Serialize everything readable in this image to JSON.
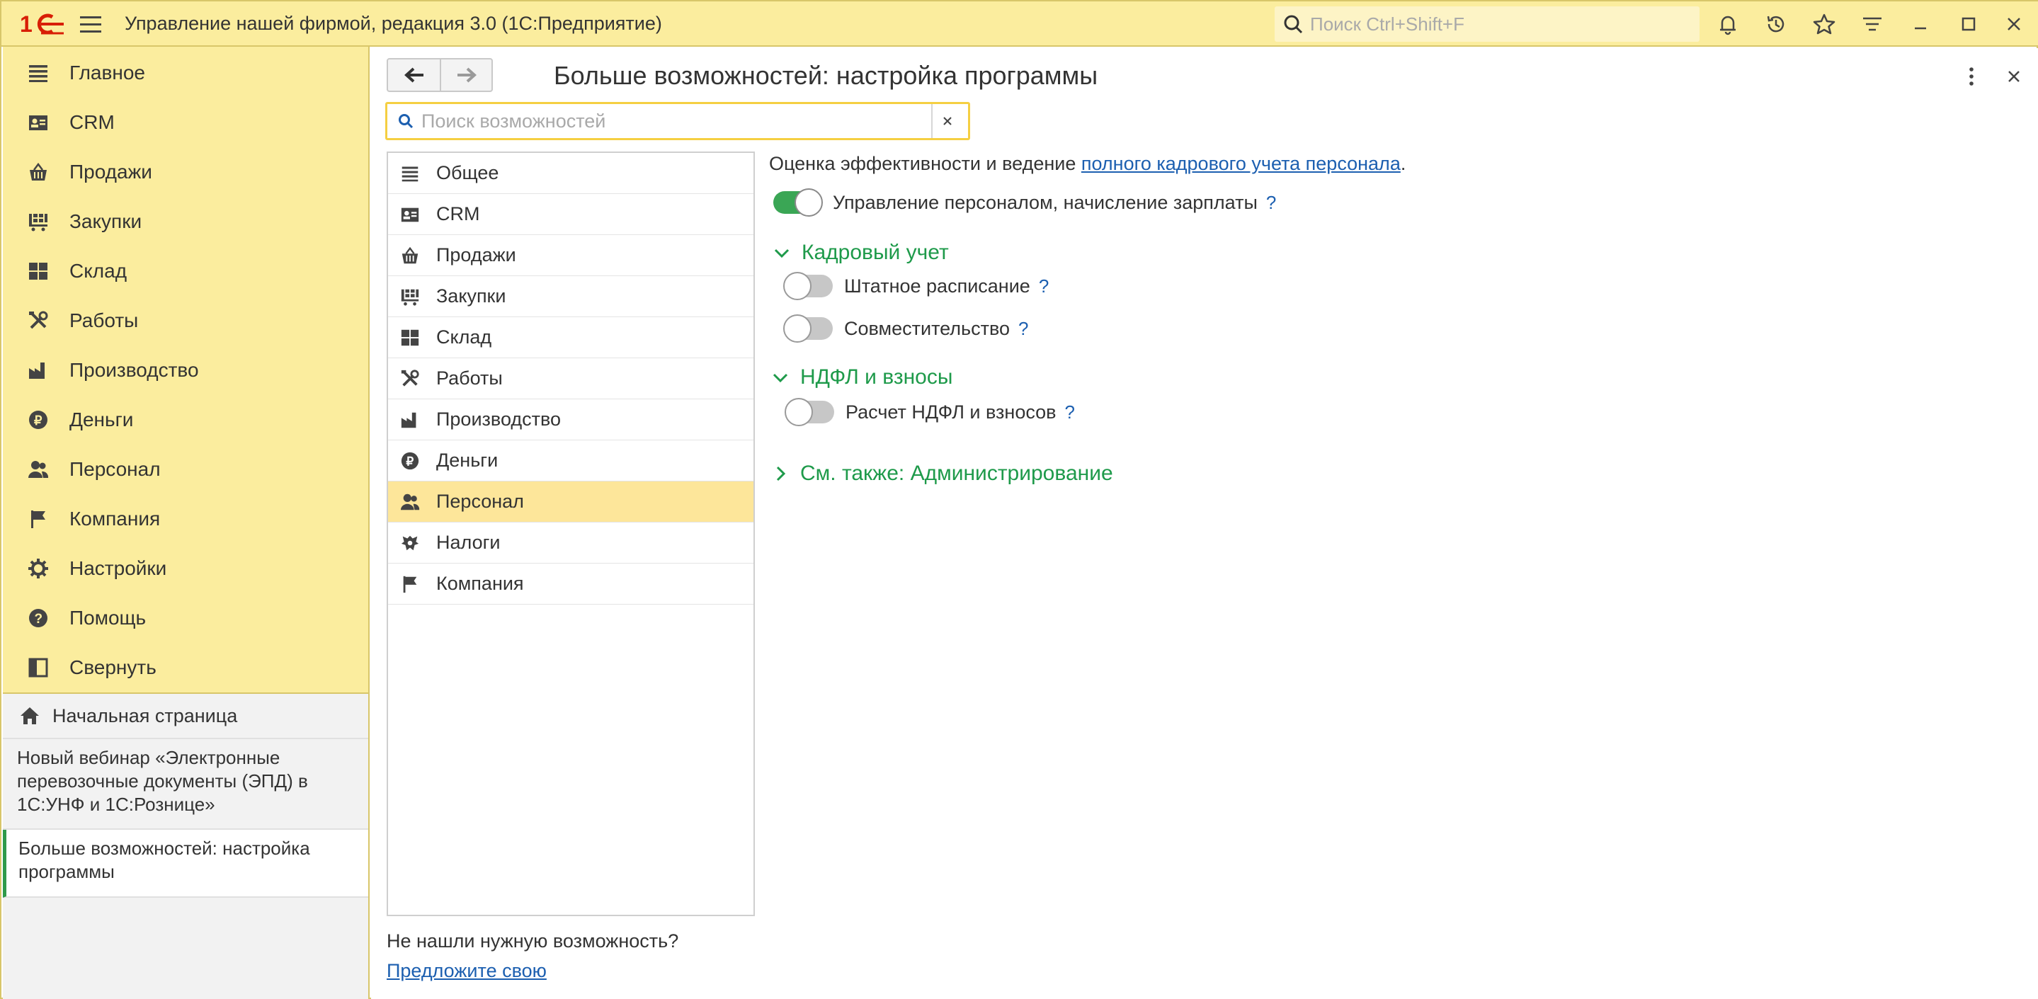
{
  "titlebar": {
    "app_title": "Управление нашей фирмой, редакция 3.0  (1С:Предприятие)",
    "search_placeholder": "Поиск Ctrl+Shift+F",
    "brand_color": "#d81e05",
    "accent_color": "#fbed9e"
  },
  "sidebar": {
    "items": [
      {
        "label": "Главное",
        "icon": "menu-lines-icon"
      },
      {
        "label": "CRM",
        "icon": "crm-card-icon"
      },
      {
        "label": "Продажи",
        "icon": "basket-icon"
      },
      {
        "label": "Закупки",
        "icon": "cart-icon"
      },
      {
        "label": "Склад",
        "icon": "warehouse-grid-icon"
      },
      {
        "label": "Работы",
        "icon": "tools-icon"
      },
      {
        "label": "Производство",
        "icon": "factory-icon"
      },
      {
        "label": "Деньги",
        "icon": "ruble-icon"
      },
      {
        "label": "Персонал",
        "icon": "people-icon"
      },
      {
        "label": "Компания",
        "icon": "flag-icon"
      },
      {
        "label": "Настройки",
        "icon": "gear-icon"
      },
      {
        "label": "Помощь",
        "icon": "help-icon"
      },
      {
        "label": "Свернуть",
        "icon": "collapse-panel-icon"
      }
    ]
  },
  "open_windows": {
    "home_label": "Начальная страница",
    "items": [
      {
        "label": "Новый вебинар «Электронные перевозочные документы (ЭПД) в 1С:УНФ и 1С:Рознице»",
        "active": false
      },
      {
        "label": "Больше возможностей: настройка программы",
        "active": true
      }
    ]
  },
  "main": {
    "title": "Больше возможностей: настройка программы",
    "search_placeholder": "Поиск возможностей",
    "sections": [
      {
        "label": "Общее",
        "active": false
      },
      {
        "label": "CRM",
        "active": false
      },
      {
        "label": "Продажи",
        "active": false
      },
      {
        "label": "Закупки",
        "active": false
      },
      {
        "label": "Склад",
        "active": false
      },
      {
        "label": "Работы",
        "active": false
      },
      {
        "label": "Производство",
        "active": false
      },
      {
        "label": "Деньги",
        "active": false
      },
      {
        "label": "Персонал",
        "active": true
      },
      {
        "label": "Налоги",
        "active": false
      },
      {
        "label": "Компания",
        "active": false
      }
    ],
    "not_found_text": "Не нашли нужную возможность?",
    "suggest_link": "Предложите свою"
  },
  "pane": {
    "intro_text": "Оценка эффективности и ведение ",
    "intro_link": "полного кадрового учета персонала",
    "intro_end": ".",
    "main_toggle": {
      "label": "Управление персоналом, начисление зарплаты",
      "on": true,
      "help": "?"
    },
    "groups": [
      {
        "title": "Кадровый учет",
        "expanded": true,
        "toggles": [
          {
            "label": "Штатное расписание",
            "on": false,
            "help": "?"
          },
          {
            "label": "Совместительство",
            "on": false,
            "help": "?"
          }
        ]
      },
      {
        "title": "НДФЛ и взносы",
        "expanded": true,
        "toggles": [
          {
            "label": "Расчет НДФЛ и взносов",
            "on": false,
            "help": "?"
          }
        ]
      },
      {
        "title": "См. также: Администрирование",
        "expanded": false,
        "toggles": []
      }
    ]
  }
}
